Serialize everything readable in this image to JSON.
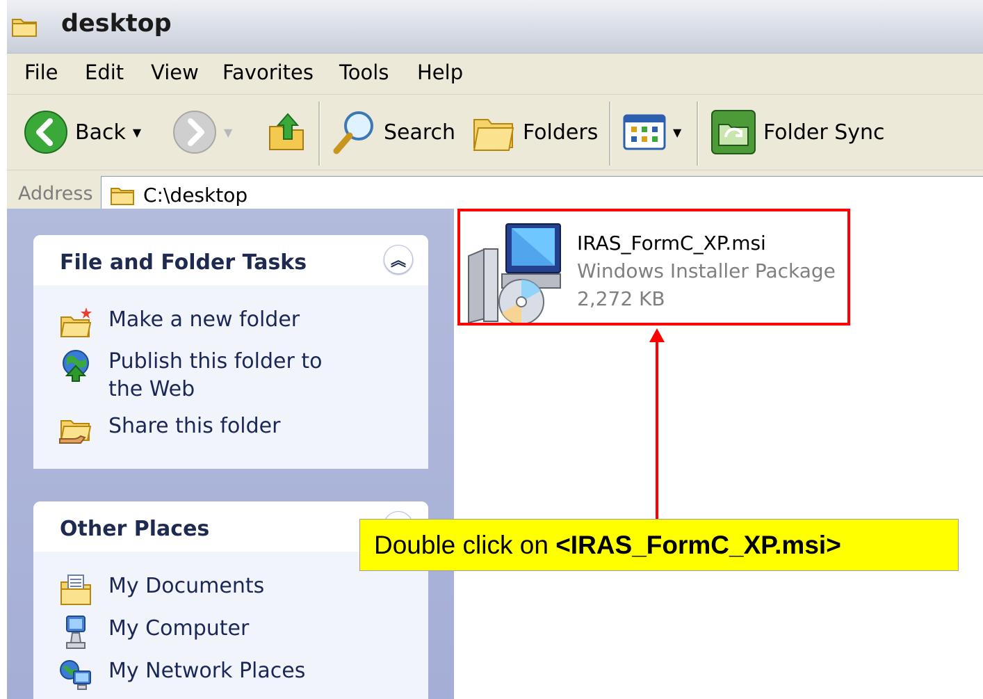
{
  "window": {
    "title": "desktop"
  },
  "menu": [
    "File",
    "Edit",
    "View",
    "Favorites",
    "Tools",
    "Help"
  ],
  "toolbar": {
    "back_label": "Back",
    "search_label": "Search",
    "folders_label": "Folders",
    "folder_sync_label": "Folder Sync"
  },
  "address": {
    "label": "Address",
    "value": "C:\\desktop"
  },
  "tasks_panel": {
    "title": "File and Folder Tasks",
    "items": [
      "Make a new folder",
      "Publish this folder to the Web",
      "Share this folder"
    ]
  },
  "places_panel": {
    "title": "Other Places",
    "items": [
      "My Documents",
      "My Computer",
      "My Network Places"
    ]
  },
  "file": {
    "name": "IRAS_FormC_XP.msi",
    "type": "Windows Installer Package",
    "size": "2,272 KB"
  },
  "callout": {
    "prefix": "Double click on ",
    "target": "<IRAS_FormC_XP.msi>"
  },
  "colors": {
    "highlight": "#ff0000",
    "callout_bg": "#ffff00",
    "task_pane": "#a9b1d8",
    "toolbar_bg": "#ece9d8"
  },
  "icons": [
    "folder-icon",
    "back-arrow-icon",
    "forward-arrow-icon",
    "up-folder-icon",
    "search-icon",
    "folders-icon",
    "views-icon",
    "folder-sync-icon",
    "new-folder-icon",
    "publish-web-icon",
    "share-folder-icon",
    "my-documents-icon",
    "my-computer-icon",
    "my-network-places-icon",
    "installer-package-icon"
  ]
}
